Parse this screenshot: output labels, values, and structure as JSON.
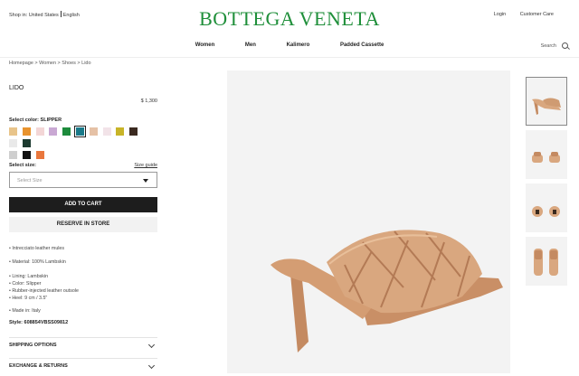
{
  "header": {
    "shop_in": "Shop in: United States",
    "language": "English",
    "brand": "BOTTEGA VENETA",
    "login": "Login",
    "customer_care": "Customer Care",
    "nav": [
      "Women",
      "Men",
      "Kalimero",
      "Padded Cassette"
    ],
    "search_label": "Search"
  },
  "breadcrumb": "Homepage  >  Women  >  Shoes  >  Lido",
  "product": {
    "name": "LIDO",
    "price": "$ 1,300",
    "color_label": "Select color: SLIPPER",
    "swatch_colors": [
      "#e8c48a",
      "#e8932e",
      "#f3d6d6",
      "#c9a8d3",
      "#1d8b3c",
      "#1a7a8a",
      "#e5c1a6",
      "#f2e3e8",
      "#c8b428",
      "#3b2a20",
      "#e9e9e9",
      "#1d3b30",
      "#cfcfcf",
      "#111111",
      "#e9773d"
    ],
    "selected_swatch": 5,
    "size_label": "Select size:",
    "size_guide": "Size guide",
    "size_placeholder": "Select Size",
    "add_to_cart": "ADD TO CART",
    "reserve": "RESERVE IN STORE",
    "details": [
      "• Intrecciato leather mules",
      "• Material: 100% Lambskin",
      "• Lining: Lambskin",
      "• Color: Slipper",
      "• Rubber-injected leather outsole",
      "• Heel: 9 cm / 3.5\"",
      "• Made in: Italy"
    ],
    "style": "Style: 608854VBSS09812",
    "accordions": [
      "SHIPPING OPTIONS",
      "EXCHANGE & RETURNS"
    ]
  },
  "colors": {
    "brand_green": "#1f8f3a",
    "shoe_tan": "#d9a77f",
    "cart_black": "#1d1d1d"
  }
}
